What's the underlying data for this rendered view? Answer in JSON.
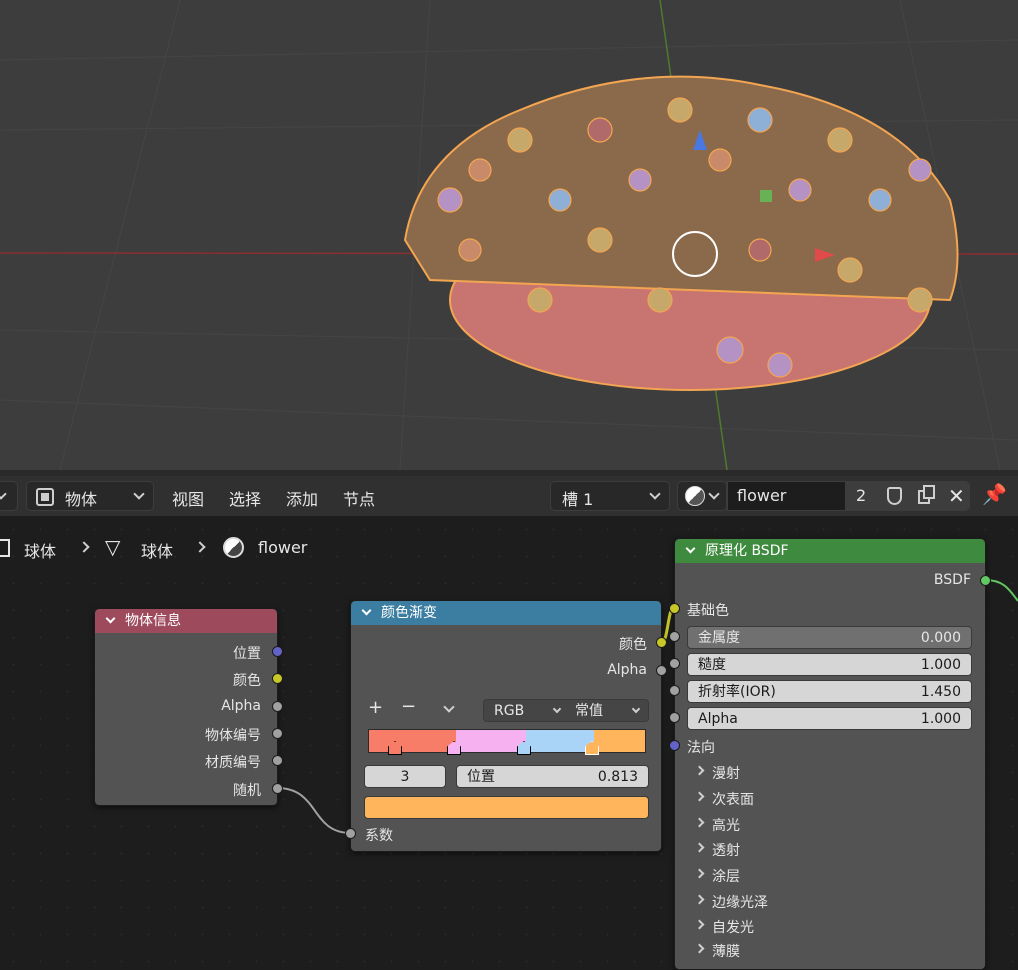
{
  "header": {
    "mode_label": "物体",
    "menus": [
      "视图",
      "选择",
      "添加",
      "节点"
    ],
    "slot_label": "槽 1",
    "material_name": "flower",
    "user_count": "2"
  },
  "breadcrumb": [
    "球体",
    "球体",
    "flower"
  ],
  "nodes": {
    "object_info": {
      "title": "物体信息",
      "outputs": [
        "位置",
        "颜色",
        "Alpha",
        "物体编号",
        "材质编号",
        "随机"
      ]
    },
    "color_ramp": {
      "title": "颜色渐变",
      "outputs": [
        "颜色",
        "Alpha"
      ],
      "color_mode": "RGB",
      "interpolation": "常值",
      "stop_index": "3",
      "position_label": "位置",
      "position_value": "0.813",
      "stop_colors": [
        "#f77d69",
        "#f6b2f0",
        "#a9d4f7",
        "#ffb55b"
      ],
      "input": "系数",
      "active_color": "#ffb55b"
    },
    "bsdf": {
      "title": "原理化 BSDF",
      "output": "BSDF",
      "base_color": "基础色",
      "fields": [
        {
          "label": "金属度",
          "value": "0.000"
        },
        {
          "label": "糙度",
          "value": "1.000"
        },
        {
          "label": "折射率(IOR)",
          "value": "1.450"
        },
        {
          "label": "Alpha",
          "value": "1.000"
        }
      ],
      "normal": "法向",
      "panels": [
        "漫射",
        "次表面",
        "高光",
        "透射",
        "涂层",
        "边缘光泽",
        "自发光",
        "薄膜"
      ]
    }
  },
  "colors": {
    "object_info_header": "#9e4a5d",
    "color_ramp_header": "#3b7ea1",
    "bsdf_header": "#3e8a3e",
    "viewport_bg": "#3d3d3d"
  }
}
